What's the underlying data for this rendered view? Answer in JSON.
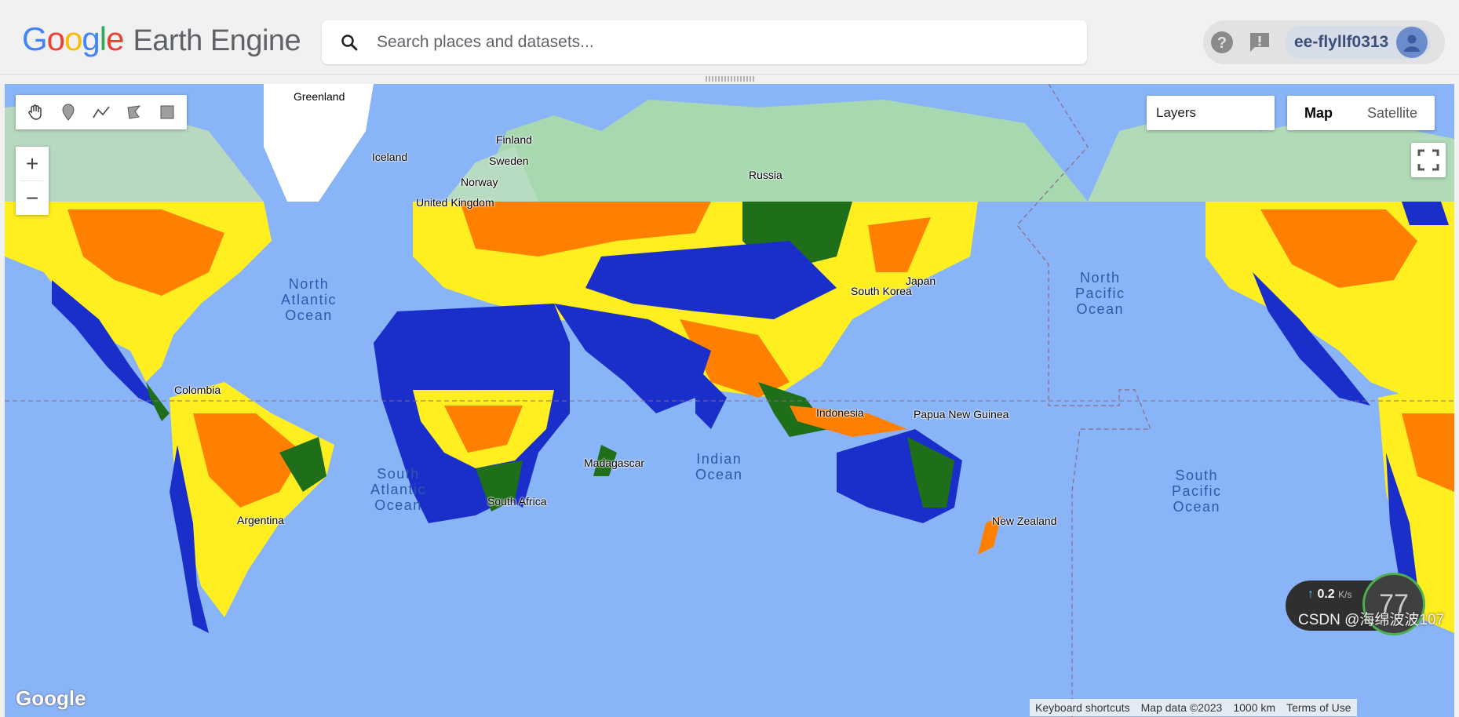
{
  "header": {
    "logo_letters": [
      {
        "char": "G",
        "color": "#4285F4"
      },
      {
        "char": "o",
        "color": "#EA4335"
      },
      {
        "char": "o",
        "color": "#FBBC05"
      },
      {
        "char": "g",
        "color": "#4285F4"
      },
      {
        "char": "l",
        "color": "#34A853"
      },
      {
        "char": "e",
        "color": "#EA4335"
      }
    ],
    "logo_suffix": "Earth Engine",
    "search_placeholder": "Search places and datasets...",
    "help_icon": "help-circle-icon",
    "feedback_icon": "feedback-icon",
    "account_name": "ee-flyllf0313",
    "avatar_icon": "account-circle-icon"
  },
  "map": {
    "drawing_tools": [
      "hand-pan-icon",
      "marker-icon",
      "polyline-icon",
      "polygon-icon",
      "rectangle-icon"
    ],
    "zoom_in": "+",
    "zoom_out": "−",
    "layers_label": "Layers",
    "map_type": {
      "map": "Map",
      "satellite": "Satellite",
      "selected": "Map"
    },
    "fullscreen_icon": "fullscreen-icon",
    "labels": {
      "greenland": "Greenland",
      "finland": "Finland",
      "iceland": "Iceland",
      "sweden": "Sweden",
      "norway": "Norway",
      "russia": "Russia",
      "united_kingdom": "United Kingdom",
      "japan": "Japan",
      "south_korea": "South Korea",
      "indonesia": "Indonesia",
      "papua_new_guinea": "Papua New Guinea",
      "madagascar": "Madagascar",
      "south_africa": "South Africa",
      "new_zealand": "New Zealand",
      "colombia": "Colombia",
      "argentina": "Argentina"
    },
    "oceans": {
      "north_atlantic": "North\nAtlantic\nOcean",
      "north_pacific": "North\nPacific\nOcean",
      "south_atlantic": "South\nAtlantic\nOcean",
      "indian": "Indian\nOcean",
      "south_pacific": "South\nPacific\nOcean"
    },
    "google_logo": "Google",
    "attribution": {
      "keyboard_shortcuts": "Keyboard shortcuts",
      "map_data": "Map data ©2023",
      "scale": "1000 km",
      "terms": "Terms of Use"
    },
    "legend_colors": [
      "#1a2fc9",
      "#1f6e1a",
      "#c8e020",
      "#ffff20",
      "#ff7a00"
    ]
  },
  "overlay": {
    "upload_speed": "0.2",
    "speed_unit": "K/s",
    "gauge_value": "77",
    "watermark": "CSDN @海绵波波107"
  }
}
